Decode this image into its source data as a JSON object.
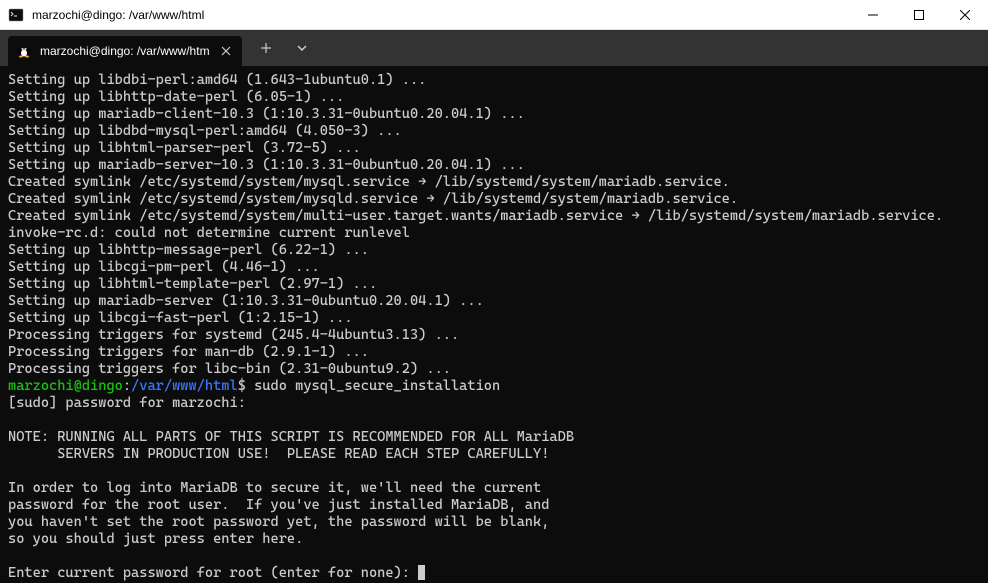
{
  "window": {
    "title": "marzochi@dingo: /var/www/html"
  },
  "tab": {
    "title": "marzochi@dingo: /var/www/htm"
  },
  "terminal": {
    "lines": [
      "Setting up libdbi-perl:amd64 (1.643-1ubuntu0.1) ...",
      "Setting up libhttp-date-perl (6.05-1) ...",
      "Setting up mariadb-client-10.3 (1:10.3.31-0ubuntu0.20.04.1) ...",
      "Setting up libdbd-mysql-perl:amd64 (4.050-3) ...",
      "Setting up libhtml-parser-perl (3.72-5) ...",
      "Setting up mariadb-server-10.3 (1:10.3.31-0ubuntu0.20.04.1) ...",
      "Created symlink /etc/systemd/system/mysql.service → /lib/systemd/system/mariadb.service.",
      "Created symlink /etc/systemd/system/mysqld.service → /lib/systemd/system/mariadb.service.",
      "Created symlink /etc/systemd/system/multi-user.target.wants/mariadb.service → /lib/systemd/system/mariadb.service.",
      "invoke-rc.d: could not determine current runlevel",
      "Setting up libhttp-message-perl (6.22-1) ...",
      "Setting up libcgi-pm-perl (4.46-1) ...",
      "Setting up libhtml-template-perl (2.97-1) ...",
      "Setting up mariadb-server (1:10.3.31-0ubuntu0.20.04.1) ...",
      "Setting up libcgi-fast-perl (1:2.15-1) ...",
      "Processing triggers for systemd (245.4-4ubuntu3.13) ...",
      "Processing triggers for man-db (2.9.1-1) ...",
      "Processing triggers for libc-bin (2.31-0ubuntu9.2) ..."
    ],
    "prompt": {
      "user_host": "marzochi@dingo",
      "colon": ":",
      "path": "/var/www/html",
      "dollar": "$ ",
      "command": "sudo mysql_secure_installation"
    },
    "after_prompt": [
      "[sudo] password for marzochi:",
      "",
      "NOTE: RUNNING ALL PARTS OF THIS SCRIPT IS RECOMMENDED FOR ALL MariaDB",
      "      SERVERS IN PRODUCTION USE!  PLEASE READ EACH STEP CAREFULLY!",
      "",
      "In order to log into MariaDB to secure it, we'll need the current",
      "password for the root user.  If you've just installed MariaDB, and",
      "you haven't set the root password yet, the password will be blank,",
      "so you should just press enter here.",
      ""
    ],
    "input_prompt": "Enter current password for root (enter for none): "
  }
}
